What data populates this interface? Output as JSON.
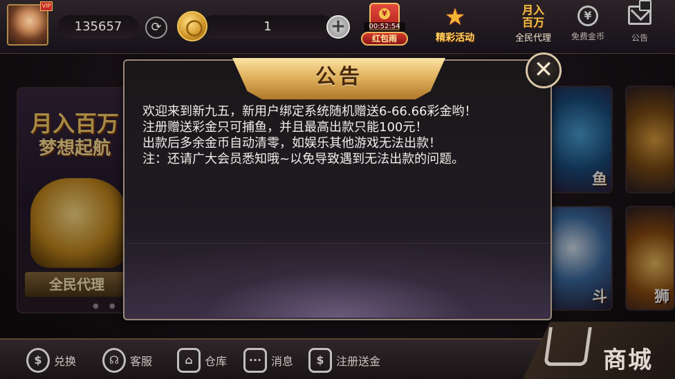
{
  "header": {
    "user_id": "135657",
    "coins": "1",
    "red_packet": {
      "timer": "00:52:54",
      "label": "红包雨"
    },
    "activity_label": "精彩活动",
    "agent": {
      "headline": "月入\n百万",
      "label": "全民代理"
    },
    "free_coins_label": "免费金币",
    "notice_label": "公告",
    "avatar_badge": "VIP"
  },
  "banner": {
    "line1": "月入百万",
    "line2": "梦想起航",
    "bottom": "全民代理"
  },
  "game_cards": {
    "fish_label": "鱼",
    "poker_label": "斗",
    "dragon_label": "狮"
  },
  "modal": {
    "title": "公告",
    "close_symbol": "✕",
    "lines": [
      "欢迎来到新九五，新用户绑定系统随机赠送6-66.66彩金哟！",
      "注册赠送彩金只可捕鱼，并且最高出款只能100元！",
      "出款后多余金币自动清零，如娱乐其他游戏无法出款！",
      "注：还请广大会员悉知哦~以免导致遇到无法出款的问题。"
    ]
  },
  "footer": {
    "exchange": "兑换",
    "service": "客服",
    "warehouse": "仓库",
    "messages": "消息",
    "register_bonus": "注册送金",
    "shop": "商城"
  },
  "colors": {
    "gold_accent": "#e1b35e",
    "modal_bg": "#1a1719",
    "text": "#f2eeea"
  }
}
